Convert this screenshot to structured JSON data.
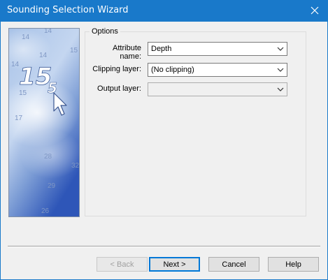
{
  "window": {
    "title": "Sounding Selection Wizard",
    "close_icon": "close-icon"
  },
  "banner": {
    "soundings": [
      "14",
      "14",
      "14",
      "14",
      "15",
      "15",
      "5",
      "15",
      "17",
      "28",
      "32",
      "29",
      "26"
    ],
    "icon": "cursor-arrow-icon"
  },
  "options": {
    "group_label": "Options",
    "attribute_label": "Attribute name:",
    "attribute_value": "Depth",
    "clipping_label": "Clipping layer:",
    "clipping_value": "(No clipping)",
    "output_label": "Output layer:",
    "output_value": ""
  },
  "buttons": {
    "back": "< Back",
    "next": "Next >",
    "cancel": "Cancel",
    "help": "Help"
  },
  "colors": {
    "title_bar": "#1979ca",
    "focus": "#0078d7"
  }
}
